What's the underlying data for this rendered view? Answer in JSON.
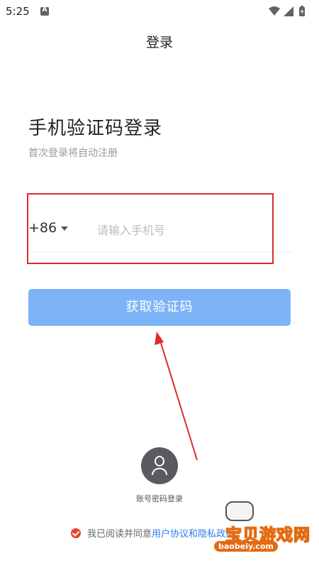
{
  "status_bar": {
    "time": "5:25",
    "icons": [
      "notification-a-icon",
      "wifi-icon",
      "cellular-icon",
      "battery-icon"
    ]
  },
  "nav": {
    "title": "登录"
  },
  "login": {
    "heading": "手机验证码登录",
    "subheading": "首次登录将自动注册",
    "country_code": "+86",
    "phone_placeholder": "请输入手机号",
    "phone_value": "",
    "get_code_button": "获取验证码"
  },
  "alt_login": {
    "label": "账号密码登录",
    "icon": "user-avatar-icon"
  },
  "agreement": {
    "checked": true,
    "prefix": "我已阅读并同意",
    "link_text": "用户协议",
    "link2_text": "和隐私政策"
  },
  "watermark": {
    "text": "宝贝游戏网",
    "url": "baobeiy.com"
  },
  "colors": {
    "primary_button": "#7eb4f7",
    "link": "#2b7ce9",
    "check": "#e8432c",
    "annotation": "#e02a2a"
  }
}
